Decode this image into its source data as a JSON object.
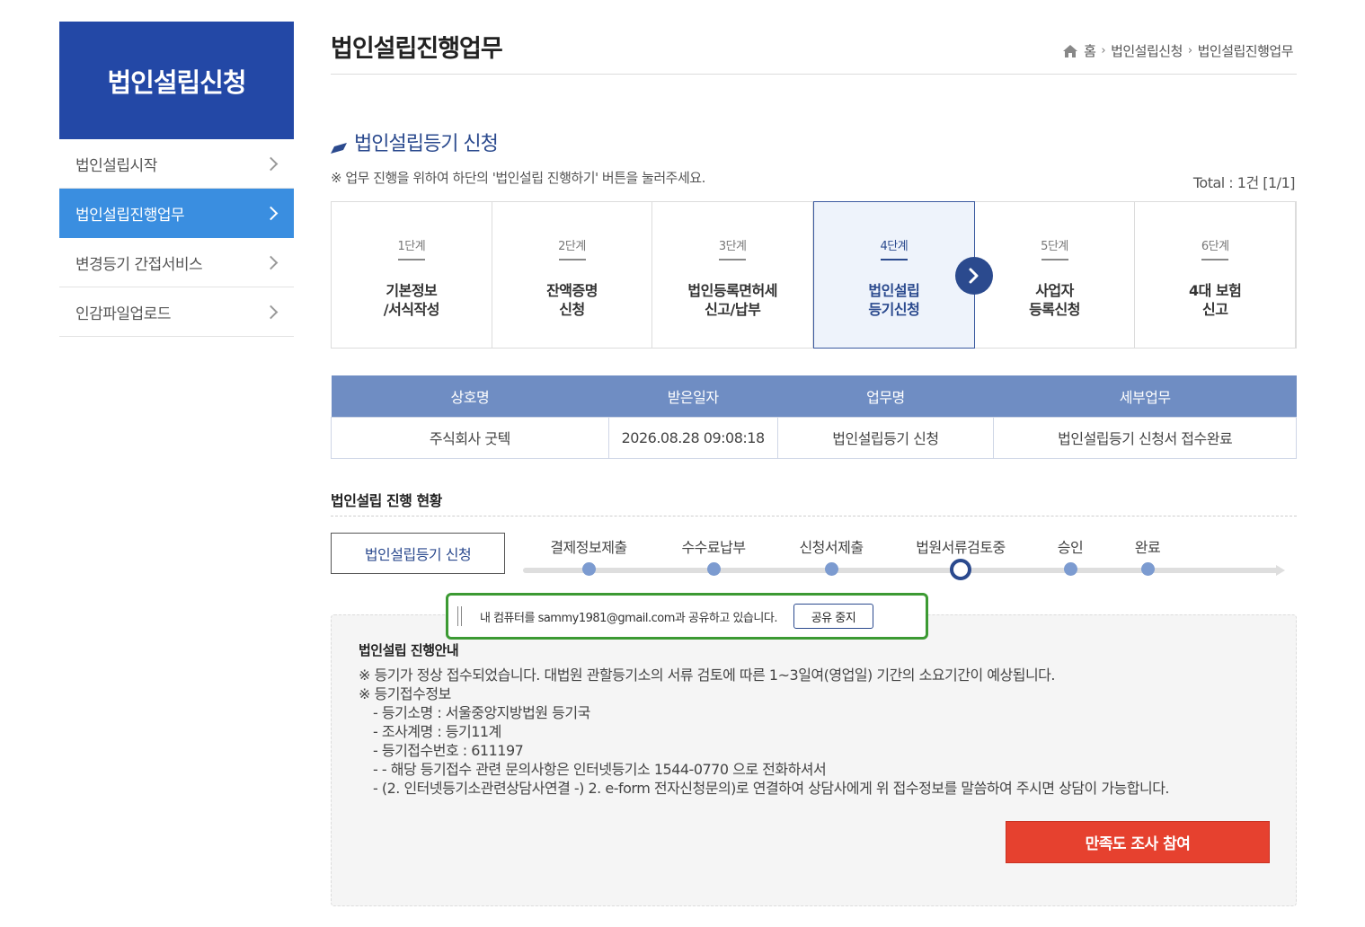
{
  "sidebar": {
    "title": "법인설립신청",
    "items": [
      {
        "label": "법인설립시작"
      },
      {
        "label": "법인설립진행업무"
      },
      {
        "label": "변경등기 간접서비스"
      },
      {
        "label": "인감파일업로드"
      }
    ]
  },
  "header": {
    "title": "법인설립진행업무",
    "breadcrumb": [
      "홈",
      "법인설립신청",
      "법인설립진행업무"
    ]
  },
  "section": {
    "title": "법인설립등기 신청",
    "notice": "※ 업무 진행을 위하여 하단의 '법인설립 진행하기' 버튼을 눌러주세요.",
    "total": "Total : 1건 [1/1]"
  },
  "steps": [
    {
      "num": "1단계",
      "line1": "기본정보",
      "line2": "/서식작성"
    },
    {
      "num": "2단계",
      "line1": "잔액증명",
      "line2": "신청"
    },
    {
      "num": "3단계",
      "line1": "법인등록면허세",
      "line2": "신고/납부"
    },
    {
      "num": "4단계",
      "line1": "법인설립",
      "line2": "등기신청"
    },
    {
      "num": "5단계",
      "line1": "사업자",
      "line2": "등록신청"
    },
    {
      "num": "6단계",
      "line1": "4대 보험",
      "line2": "신고"
    }
  ],
  "table": {
    "headers": [
      "상호명",
      "받은일자",
      "업무명",
      "세부업무"
    ],
    "row": [
      "주식회사 굿텍",
      "2026.08.28 09:08:18",
      "법인설립등기 신청",
      "법인설립등기 신청서 접수완료"
    ]
  },
  "status": {
    "title": "법인설립 진행 현황",
    "box": "법인설립등기 신청",
    "points": [
      "결제정보제출",
      "수수료납부",
      "신청서제출",
      "법원서류검토중",
      "승인",
      "완료"
    ],
    "current_index": 3
  },
  "guide": {
    "title": "법인설립 진행안내",
    "lines": [
      "※ 등기가 정상 접수되었습니다. 대법원 관할등기소의 서류 검토에 따른 1~3일여(영업일) 기간의 소요기간이 예상됩니다.",
      "※ 등기접수정보",
      "- 등기소명 : 서울중앙지방법원 등기국",
      "- 조사계명 : 등기11계",
      "- 등기접수번호 : 611197",
      "- - 해당 등기접수 관련 문의사항은 인터넷등기소 1544-0770 으로 전화하셔서",
      "- (2. 인터넷등기소관련상담사연결 -) 2. e-form 전자신청문의)로 연결하여 상담사에게 위 접수정보를 말씀하여 주시면 상담이 가능합니다."
    ],
    "survey_button": "만족도 조사 참여"
  },
  "share_bar": {
    "text": "내 컴퓨터를 sammy1981@gmail.com과 공유하고 있습니다.",
    "stop_button": "공유 중지"
  },
  "colors": {
    "brand_dark": "#2348a6",
    "active_blue": "#3a8ee0",
    "table_header": "#6f8dc3",
    "survey_red": "#e6412f",
    "share_green": "#3c9a33"
  }
}
